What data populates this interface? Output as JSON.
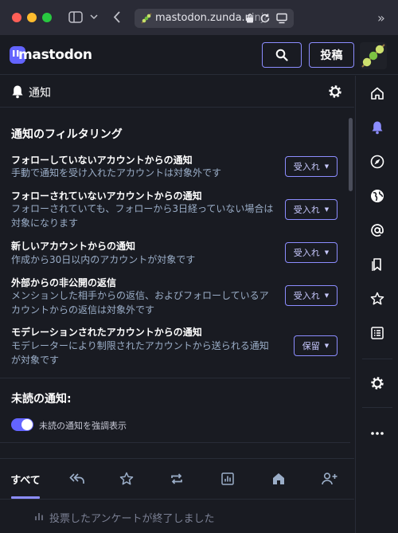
{
  "browser": {
    "url": "mastodon.zunda.ninja"
  },
  "header": {
    "logo_text": "mastodon",
    "post_button": "投稿"
  },
  "column": {
    "title": "通知"
  },
  "filter_section": {
    "title": "通知のフィルタリング",
    "rows": [
      {
        "title": "フォローしていないアカウントからの通知",
        "desc": "手動で通知を受け入れたアカウントは対象外です",
        "value": "受入れ"
      },
      {
        "title": "フォローされていないアカウントからの通知",
        "desc": "フォローされていても、フォローから3日経っていない場合は対象になります",
        "value": "受入れ"
      },
      {
        "title": "新しいアカウントからの通知",
        "desc": "作成から30日以内のアカウントが対象です",
        "value": "受入れ"
      },
      {
        "title": "外部からの非公開の返信",
        "desc": "メンションした相手からの返信、およびフォローしているアカウントからの返信は対象外です",
        "value": "受入れ"
      },
      {
        "title": "モデレーションされたアカウントからの通知",
        "desc": "モデレーターにより制限されたアカウントから送られる通知が対象です",
        "value": "保留"
      }
    ]
  },
  "unread_section": {
    "title": "未読の通知:",
    "toggle_label": "未読の通知を強調表示",
    "toggle_on": true
  },
  "tabs": {
    "all_label": "すべて"
  },
  "notification_preview": {
    "text": "投票したアンケートが終了しました"
  },
  "colors": {
    "accent": "#8c8dff",
    "brand": "#6364ff",
    "background": "#191b22",
    "muted_text": "#9baec8"
  }
}
